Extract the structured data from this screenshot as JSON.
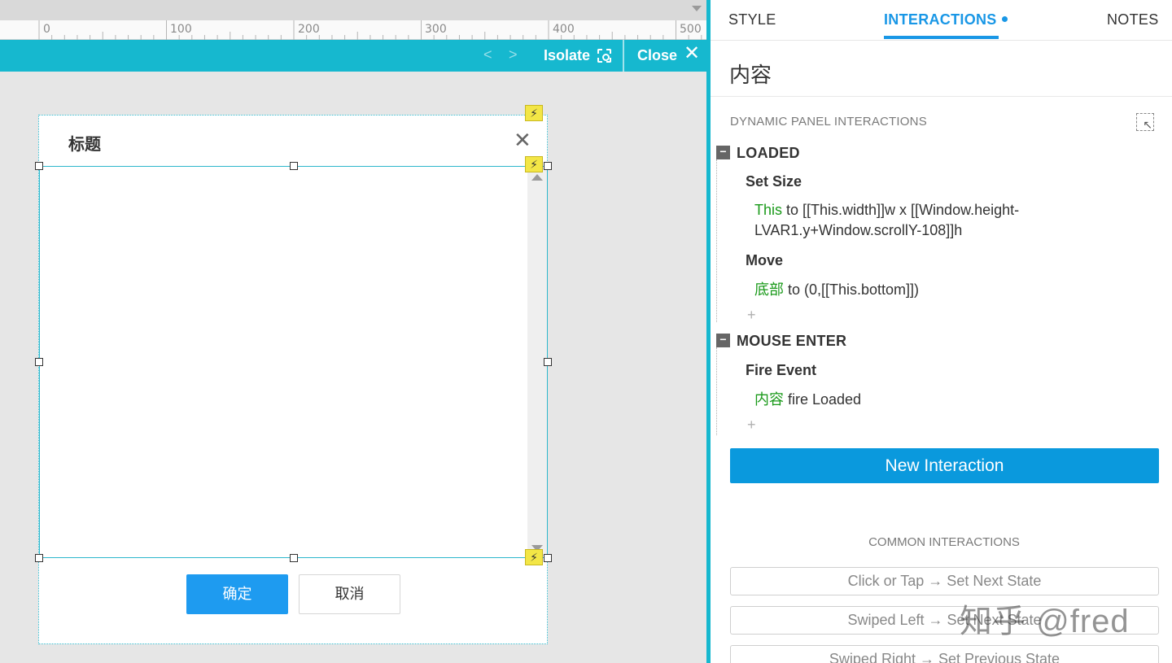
{
  "canvas": {
    "ruler_labels": [
      "0",
      "100",
      "200",
      "300",
      "400",
      "500"
    ],
    "isolate_bar": {
      "prev_arrow": "<",
      "next_arrow": ">",
      "isolate_label": "Isolate",
      "close_label": "Close",
      "close_glyph": "✕"
    },
    "dialog": {
      "title": "标题",
      "close_glyph": "✕",
      "ok_label": "确定",
      "cancel_label": "取消",
      "bolt_glyph": "⚡"
    }
  },
  "panel": {
    "tabs": [
      {
        "label": "STYLE",
        "active": false
      },
      {
        "label": "INTERACTIONS",
        "active": true
      },
      {
        "label": "NOTES",
        "active": false
      }
    ],
    "widget_name": "内容",
    "section_label": "DYNAMIC PANEL INTERACTIONS",
    "events": [
      {
        "toggle": "−",
        "name": "LOADED",
        "actions": [
          {
            "name": "Set Size",
            "target": "This",
            "detail": " to [[This.width]]w x [[Window.height-LVAR1.y+Window.scrollY-108]]h"
          },
          {
            "name": "Move",
            "target": "底部",
            "detail": " to (0,[[This.bottom]])"
          }
        ],
        "add_glyph": "+"
      },
      {
        "toggle": "−",
        "name": "MOUSE ENTER",
        "actions": [
          {
            "name": "Fire Event",
            "target": "内容",
            "detail": " fire Loaded"
          }
        ],
        "add_glyph": "+"
      }
    ],
    "new_interaction_label": "New Interaction",
    "common_label": "COMMON INTERACTIONS",
    "common_buttons": [
      "Click or Tap → Set Next State",
      "Swiped Left → Set Next State",
      "Swiped Right → Set Previous State"
    ],
    "watermark": "知乎 @fred"
  },
  "colors": {
    "accent": "#1997e6",
    "isolate_bar": "#16b8cf",
    "primary_button": "#0a99dd",
    "target_text": "#1a9a1a",
    "interaction_bolt": "#f3e646"
  }
}
